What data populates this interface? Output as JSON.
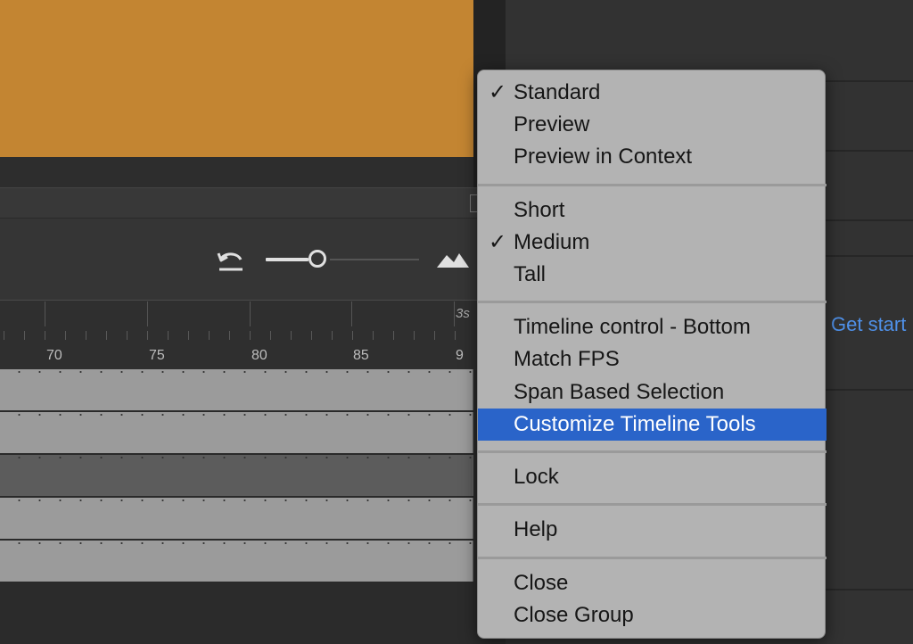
{
  "stage": {
    "color": "#c38532"
  },
  "right_panel": {
    "link_text": "Get start",
    "link_color": "#4f90e8"
  },
  "ruler": {
    "second_marker": "3s",
    "frame_labels": [
      "70",
      "75",
      "80",
      "85",
      "9"
    ]
  },
  "toolbar": {
    "undo_icon": "undo-arrow-icon",
    "size_slider_value": 0.3,
    "mountain_icon": "mountains-icon"
  },
  "context_menu": {
    "highlight_color": "#2a64c9",
    "groups": [
      {
        "items": [
          {
            "label": "Standard",
            "checked": true
          },
          {
            "label": "Preview",
            "checked": false
          },
          {
            "label": "Preview in Context",
            "checked": false
          }
        ]
      },
      {
        "items": [
          {
            "label": "Short",
            "checked": false
          },
          {
            "label": "Medium",
            "checked": true
          },
          {
            "label": "Tall",
            "checked": false
          }
        ]
      },
      {
        "items": [
          {
            "label": "Timeline control - Bottom",
            "checked": false
          },
          {
            "label": "Match FPS",
            "checked": false
          },
          {
            "label": "Span Based Selection",
            "checked": false
          },
          {
            "label": "Customize Timeline Tools",
            "checked": false,
            "highlighted": true
          }
        ]
      },
      {
        "items": [
          {
            "label": "Lock",
            "checked": false
          }
        ]
      },
      {
        "items": [
          {
            "label": "Help",
            "checked": false
          }
        ]
      },
      {
        "items": [
          {
            "label": "Close",
            "checked": false
          },
          {
            "label": "Close Group",
            "checked": false
          }
        ]
      }
    ],
    "check_glyph": "✓"
  }
}
